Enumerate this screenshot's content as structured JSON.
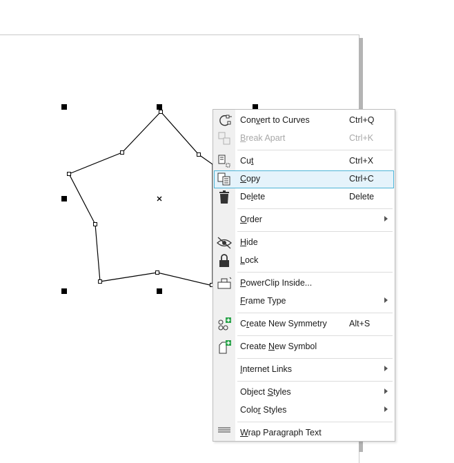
{
  "icons": {
    "convert": "convert-to-curves-icon",
    "break": "break-apart-icon",
    "cut": "cut-icon",
    "copy": "copy-icon",
    "delete": "trash-icon",
    "hide": "eye-slash-icon",
    "lock": "lock-icon",
    "powerclip": "powerclip-icon",
    "symmetry": "symmetry-icon",
    "symbol": "new-symbol-icon",
    "wrap": "wrap-text-icon"
  },
  "colors": {
    "highlight_bg": "#e5f3fb",
    "highlight_border": "#4bb3d6",
    "accent_green": "#2aa34a"
  },
  "menu": {
    "items": [
      {
        "pre": "Con",
        "ul": "v",
        "post": "ert to Curves",
        "shortcut": "Ctrl+Q"
      },
      {
        "pre": "",
        "ul": "B",
        "post": "reak Apart",
        "shortcut": "Ctrl+K"
      },
      {
        "pre": "Cu",
        "ul": "t",
        "post": "",
        "shortcut": "Ctrl+X"
      },
      {
        "pre": "",
        "ul": "C",
        "post": "opy",
        "shortcut": "Ctrl+C"
      },
      {
        "pre": "De",
        "ul": "l",
        "post": "ete",
        "shortcut": "Delete"
      },
      {
        "pre": "",
        "ul": "O",
        "post": "rder"
      },
      {
        "pre": "",
        "ul": "H",
        "post": "ide"
      },
      {
        "pre": "",
        "ul": "L",
        "post": "ock"
      },
      {
        "pre": "",
        "ul": "P",
        "post": "owerClip Inside..."
      },
      {
        "pre": "",
        "ul": "F",
        "post": "rame Type"
      },
      {
        "pre": "C",
        "ul": "r",
        "post": "eate New Symmetry",
        "shortcut": "Alt+S"
      },
      {
        "pre": "Create ",
        "ul": "N",
        "post": "ew Symbol"
      },
      {
        "pre": "",
        "ul": "I",
        "post": "nternet Links"
      },
      {
        "pre": "Object ",
        "ul": "S",
        "post": "tyles"
      },
      {
        "pre": "Colo",
        "ul": "r",
        "post": " Styles"
      },
      {
        "pre": "",
        "ul": "W",
        "post": "rap Paragraph Text"
      }
    ]
  }
}
